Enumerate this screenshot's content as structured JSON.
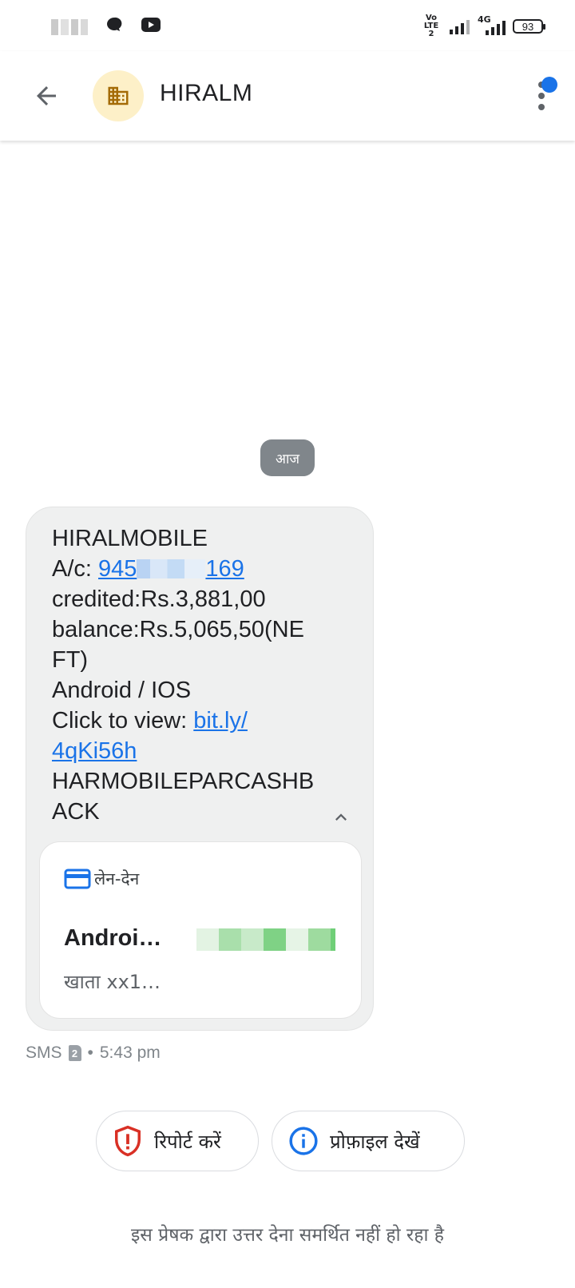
{
  "status_bar": {
    "network_label": "Vo LTE 2",
    "network_type": "4G",
    "battery": "93",
    "icons": [
      "whatsapp-icon",
      "youtube-icon",
      "signal-icon",
      "battery-icon"
    ]
  },
  "header": {
    "title": "HIRALM",
    "avatar_icon": "building-icon",
    "avatar_bg": "#fdf0c8",
    "accent": "#1a73e8"
  },
  "date_chip": "आज",
  "message": {
    "lines": [
      "HIRALMOBILE",
      "A/c: ",
      "credited:Rs.3,881,00",
      "balance:Rs.5,065,50(NE",
      "FT)",
      "Android / IOS",
      "Click to view: ",
      "HARMOBILEPARCASHB",
      "ACK"
    ],
    "account_start": "945",
    "account_end": "169",
    "link_part1": "bit.ly/",
    "link_part2": "4qKi56h"
  },
  "card": {
    "category": "लेन-देन",
    "title": "Androi…",
    "subtitle": "खाता xx1…"
  },
  "meta": {
    "type": "SMS",
    "sim": "2",
    "separator": "•",
    "time": "5:43 pm"
  },
  "actions": {
    "report_label": "रिपोर्ट करें",
    "profile_label": "प्रोफ़ाइल देखें"
  },
  "footer_note": "इस प्रेषक द्वारा उत्तर देना समर्थित नहीं हो रहा है"
}
